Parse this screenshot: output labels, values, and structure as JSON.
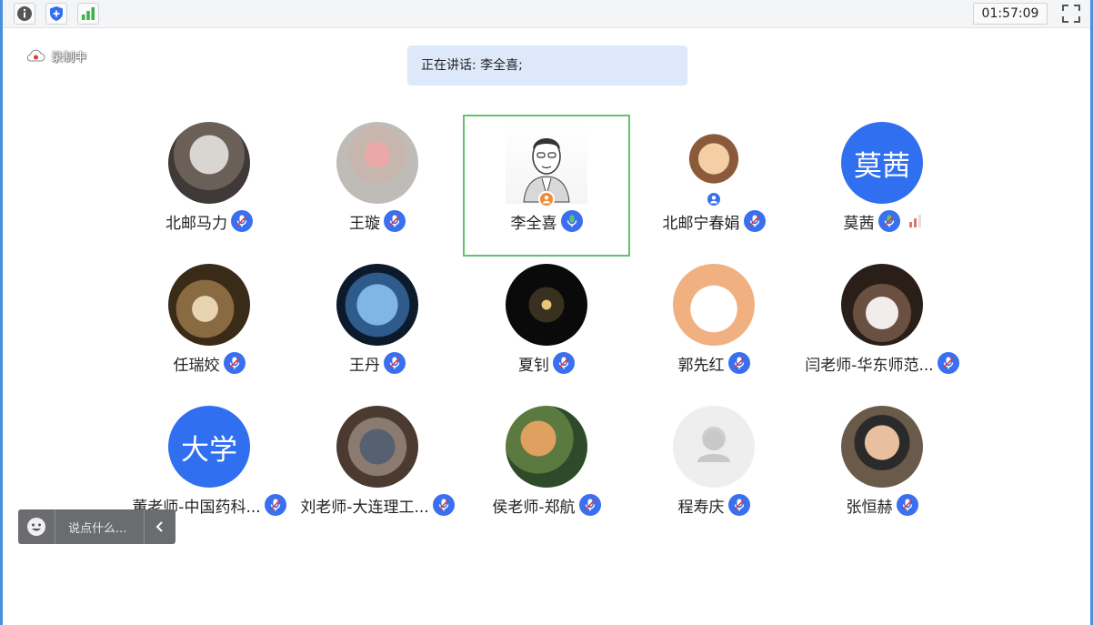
{
  "topbar": {
    "info_icon": "info-icon",
    "shield_icon": "shield-icon",
    "signal_icon": "signal-icon",
    "timer": "01:57:09",
    "fullscreen_icon": "fullscreen-icon"
  },
  "recording": {
    "label": "录制中",
    "icon": "cloud-record-icon"
  },
  "speaking": {
    "text": "正在讲话: 李全喜;"
  },
  "participants": [
    {
      "name": "北邮马力",
      "mic": "muted"
    },
    {
      "name": "王璇",
      "mic": "muted"
    },
    {
      "name": "李全喜",
      "mic": "speaking",
      "active": true,
      "badge": "host"
    },
    {
      "name": "北邮宁春娟",
      "mic": "muted",
      "badge": "cohost"
    },
    {
      "name": "莫茜",
      "mic": "unmuted",
      "avatar_text": "莫茜",
      "signal": true
    },
    {
      "name": "任瑞姣",
      "mic": "muted"
    },
    {
      "name": "王丹",
      "mic": "muted"
    },
    {
      "name": "夏钊",
      "mic": "muted"
    },
    {
      "name": "郭先红",
      "mic": "muted"
    },
    {
      "name": "闫老师-华东师范...",
      "mic": "muted"
    },
    {
      "name": "董老师-中国药科...",
      "mic": "muted",
      "avatar_text": "大学"
    },
    {
      "name": "刘老师-大连理工...",
      "mic": "muted"
    },
    {
      "name": "侯老师-郑航",
      "mic": "muted"
    },
    {
      "name": "程寿庆",
      "mic": "muted"
    },
    {
      "name": "张恒赫",
      "mic": "muted"
    }
  ],
  "chat": {
    "placeholder": "说点什么...",
    "emoji_icon": "emoji-icon",
    "collapse_icon": "chevron-left-icon"
  },
  "colors": {
    "accent": "#3a6ff0",
    "active_border": "#62c36e",
    "speaking_bg": "#dde8fa",
    "frame": "#4a8fe0"
  }
}
